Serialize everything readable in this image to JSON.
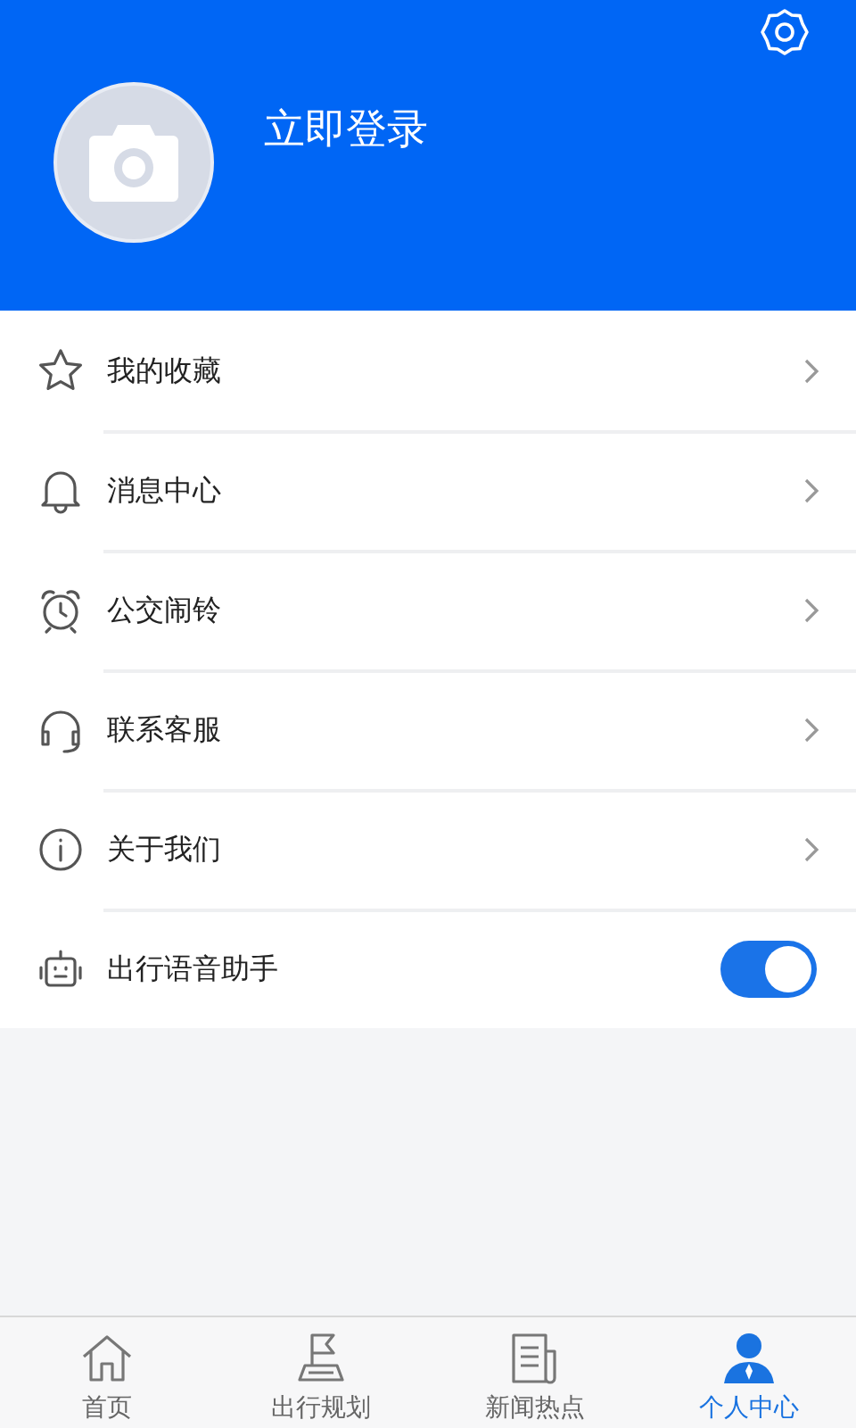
{
  "header": {
    "login_label": "立即登录"
  },
  "menu_items": [
    {
      "label": "我的收藏",
      "kind": "link"
    },
    {
      "label": "消息中心",
      "kind": "link"
    },
    {
      "label": "公交闹铃",
      "kind": "link"
    },
    {
      "label": "联系客服",
      "kind": "link"
    },
    {
      "label": "关于我们",
      "kind": "link"
    },
    {
      "label": "出行语音助手",
      "kind": "toggle",
      "on": true
    }
  ],
  "tabs": [
    {
      "label": "首页",
      "selected": false
    },
    {
      "label": "出行规划",
      "selected": false
    },
    {
      "label": "新闻热点",
      "selected": false
    },
    {
      "label": "个人中心",
      "selected": true
    }
  ]
}
